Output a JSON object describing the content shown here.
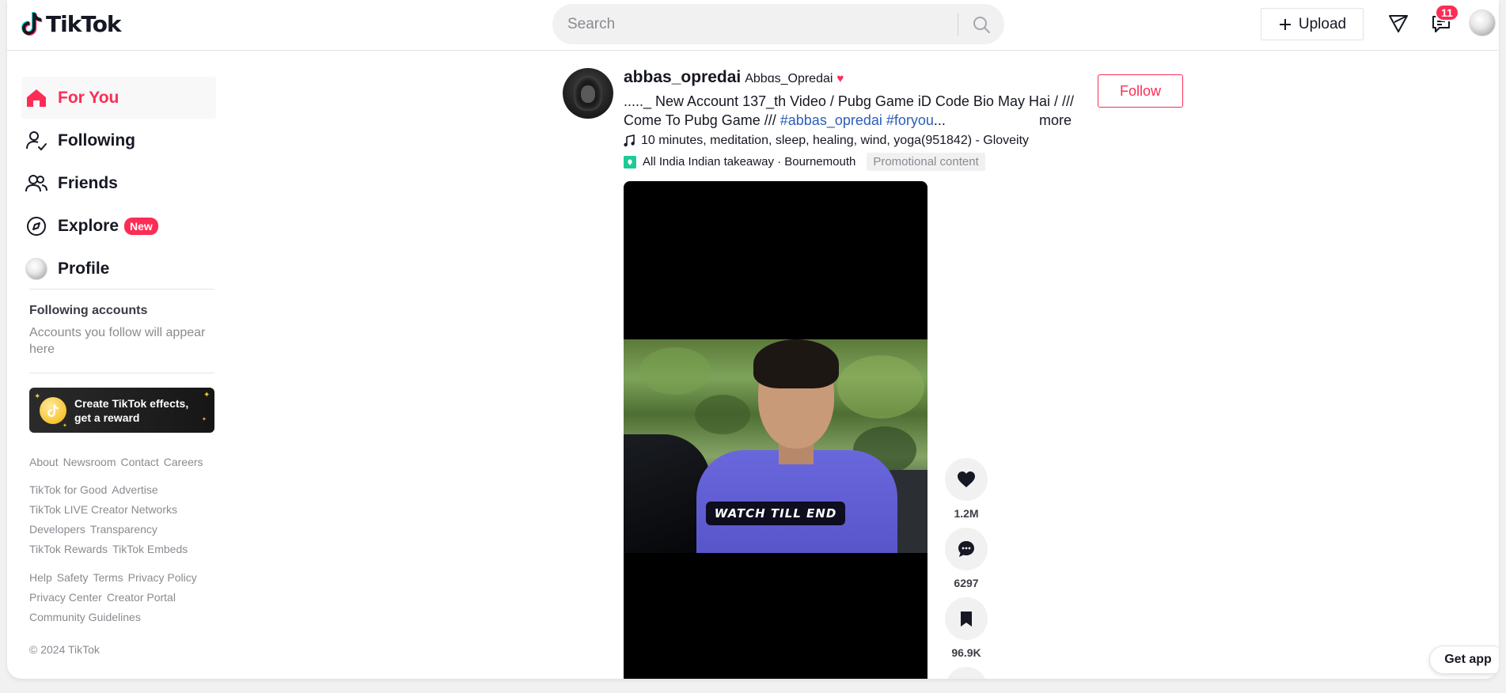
{
  "app": {
    "logo_text": "TikTok"
  },
  "search": {
    "placeholder": "Search"
  },
  "header": {
    "upload_label": "Upload",
    "inbox_badge": "11",
    "icons": [
      "plus-icon",
      "send-filter-icon",
      "inbox-icon",
      "search-icon"
    ]
  },
  "sidebar": {
    "items": [
      {
        "label": "For You",
        "icon": "home-icon",
        "active": true
      },
      {
        "label": "Following",
        "icon": "following-icon"
      },
      {
        "label": "Friends",
        "icon": "friends-icon"
      },
      {
        "label": "Explore",
        "icon": "compass-icon",
        "badge": "New"
      },
      {
        "label": "Profile",
        "icon": "avatar"
      }
    ],
    "following_heading": "Following accounts",
    "following_note": "Accounts you follow will appear here",
    "effects_banner": {
      "line1": "Create TikTok effects,",
      "line2": "get a reward"
    },
    "footer_groups": [
      [
        "About",
        "Newsroom",
        "Contact",
        "Careers"
      ],
      [
        "TikTok for Good",
        "Advertise",
        "TikTok LIVE Creator Networks",
        "Developers",
        "Transparency",
        "TikTok Rewards",
        "TikTok Embeds"
      ],
      [
        "Help",
        "Safety",
        "Terms",
        "Privacy Policy",
        "Privacy Center",
        "Creator Portal",
        "Community Guidelines"
      ]
    ],
    "copyright": "© 2024 TikTok"
  },
  "post": {
    "author_id": "abbas_opredai",
    "author_nick": "Abbɑs_Opredai",
    "nick_emoji": "♥",
    "caption_line1": "....._ New Account 137_th Video / Pubg Game iD Code Bio May Hai / ///",
    "caption_line2": "Come To Pubg Game /// ",
    "hashtags": "#abbas_opredai #foryou",
    "ellipsis": "...",
    "more_label": "more",
    "music": "10 minutes, meditation, sleep, healing, wind, yoga(951842) - Gloveity",
    "location": "All India Indian takeaway · Bournemouth",
    "promo_label": "Promotional content",
    "follow_label": "Follow",
    "video_overlay_text": "WATCH TILL END",
    "likes": "1.2M",
    "comments": "6297",
    "saves": "96.9K"
  },
  "get_app_label": "Get app",
  "colors": {
    "accent": "#fe2c55",
    "hashtag": "#2b5db9",
    "muted": "#8a8b91"
  }
}
